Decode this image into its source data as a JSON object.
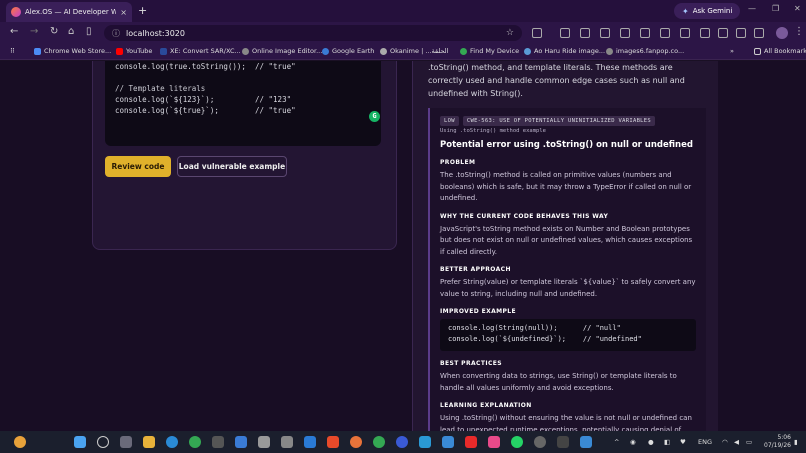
{
  "browser": {
    "tab_title": "Alex.OS — AI Developer Works...",
    "tab_close": "×",
    "new_tab": "+",
    "gemini_label": "Ask Gemini",
    "url": "localhost:3020",
    "bookmarks": [
      {
        "label": "Chrome Web Store...",
        "color": "#4c8bf5"
      },
      {
        "label": "YouTube",
        "color": "#ff0000"
      },
      {
        "label": "XE: Convert SAR/XC...",
        "color": "#2a4a9a"
      },
      {
        "label": "Online Image Editor...",
        "color": "#888888"
      },
      {
        "label": "Google Earth",
        "color": "#3a7bd5"
      },
      {
        "label": "Okanime | ...الحلقة",
        "color": "#aaaaaa"
      },
      {
        "label": "Find My Device",
        "color": "#34a853"
      },
      {
        "label": "Ao Haru Ride image...",
        "color": "#5a9ad5"
      },
      {
        "label": "images6.fanpop.co...",
        "color": "#888888"
      }
    ],
    "more_bookmarks": "»",
    "all_bookmarks": "All Bookmarks"
  },
  "editor": {
    "code_lines": [
      "console.log(true.toString());  // \"true\"",
      "",
      "// Template literals",
      "console.log(`${123}`);         // \"123\"",
      "console.log(`${true}`);        // \"true\""
    ],
    "review_button": "Review code",
    "load_button": "Load vulnerable example",
    "grammarly_badge": "G"
  },
  "review": {
    "intro": ".toString() method, and template literals. These methods are correctly used and handle common edge cases such as null and undefined with String().",
    "finding": {
      "severity": "LOW",
      "cwe": "CWE-563: USE OF POTENTIALLY UNINITIALIZED VARIABLES",
      "subtitle": "Using .toString() method example",
      "title": "Potential error using .toString() on null or undefined",
      "sections": {
        "problem_h": "PROBLEM",
        "problem_p": "The .toString() method is called on primitive values (numbers and booleans) which is safe, but it may throw a TypeError if called on null or undefined.",
        "why_h": "WHY THE CURRENT CODE BEHAVES THIS WAY",
        "why_p": "JavaScript's toString method exists on Number and Boolean prototypes but does not exist on null or undefined values, which causes exceptions if called directly.",
        "better_h": "BETTER APPROACH",
        "better_p": "Prefer String(value) or template literals `${value}` to safely convert any value to string, including null and undefined.",
        "improved_h": "IMPROVED EXAMPLE",
        "improved_code": [
          "console.log(String(null));      // \"null\"",
          "console.log(`${undefined}`);    // \"undefined\""
        ],
        "best_h": "BEST PRACTICES",
        "best_p": "When converting data to strings, use String() or template literals to handle all values uniformly and avoid exceptions.",
        "learn_h": "LEARNING EXPLANATION",
        "learn_p": "Using .toString() without ensuring the value is not null or undefined can lead to unexpected runtime exceptions, potentially causing denial of service if"
      }
    }
  },
  "taskbar": {
    "lang": "ENG",
    "time": "5:06",
    "date": "07/19/26"
  }
}
